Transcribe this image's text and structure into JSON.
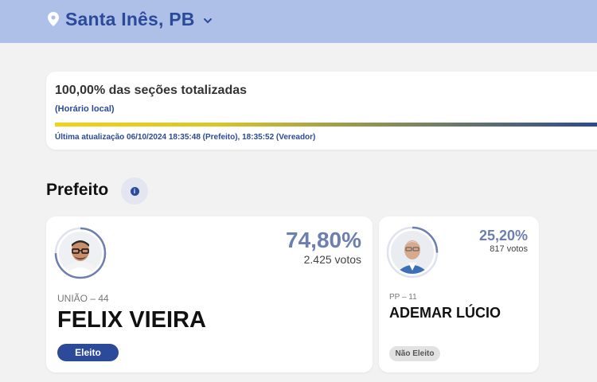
{
  "header": {
    "location": "Santa Inês, PB",
    "pin_icon": "location-pin-icon",
    "chevron_icon": "chevron-down-icon",
    "colors": {
      "bar": "#aebfe8",
      "accent": "#2b4a9a"
    }
  },
  "status": {
    "title": "100,00% das seções totalizadas",
    "local_time_note": "(Horário local)",
    "progress_percent": 100,
    "last_update": "Última atualização 06/10/2024 18:35:48 (Prefeito), 18:35:52 (Vereador)"
  },
  "section": {
    "title": "Prefeito",
    "info_icon": "info-icon"
  },
  "candidates": [
    {
      "name": "FELIX VIEIRA",
      "party": "UNIÃO – 44",
      "percent": "74,80%",
      "votes": "2.425 votos",
      "status": "Eleito",
      "share": 0.748
    },
    {
      "name": "ADEMAR LÚCIO",
      "party": "PP – 11",
      "percent": "25,20%",
      "votes": "817 votos",
      "status": "Não Eleito",
      "share": 0.252
    }
  ]
}
